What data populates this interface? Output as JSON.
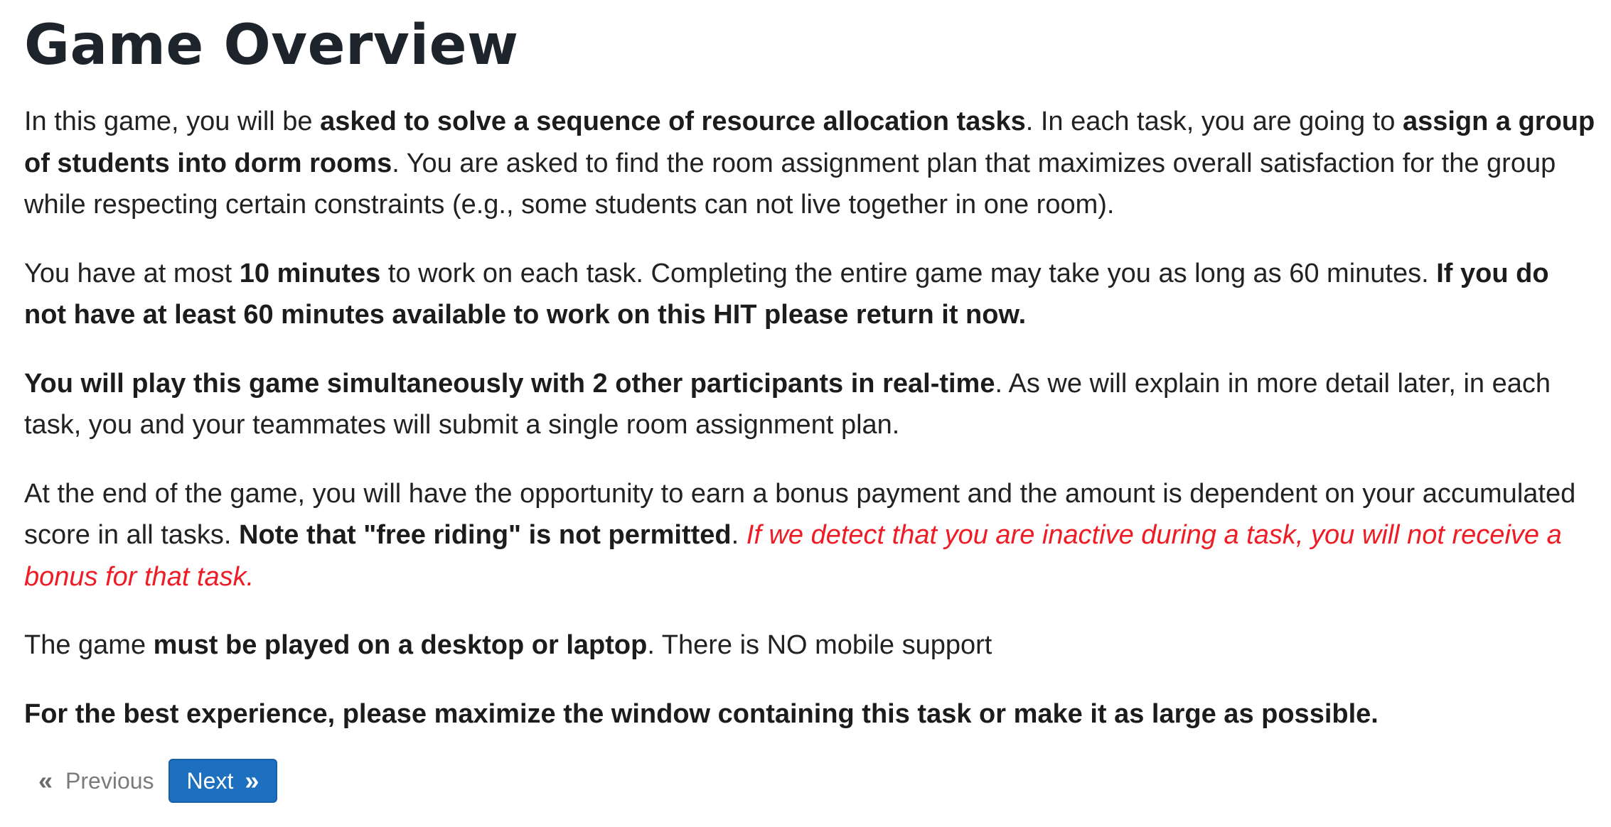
{
  "title": "Game Overview",
  "paragraphs": [
    [
      {
        "text": "In this game, you will be ",
        "style": "normal"
      },
      {
        "text": "asked to solve a sequence of resource allocation tasks",
        "style": "bold"
      },
      {
        "text": ". In each task, you are going to ",
        "style": "normal"
      },
      {
        "text": "assign a group of students into dorm rooms",
        "style": "bold"
      },
      {
        "text": ". You are asked to find the room assignment plan that maximizes overall satisfaction for the group while respecting certain constraints (e.g., some students can not live together in one room).",
        "style": "normal"
      }
    ],
    [
      {
        "text": "You have at most ",
        "style": "normal"
      },
      {
        "text": "10 minutes",
        "style": "bold"
      },
      {
        "text": " to work on each task. Completing the entire game may take you as long as 60 minutes. ",
        "style": "normal"
      },
      {
        "text": "If you do not have at least 60 minutes available to work on this HIT please return it now.",
        "style": "bold"
      }
    ],
    [
      {
        "text": "You will play this game simultaneously with 2 other participants in real-time",
        "style": "bold"
      },
      {
        "text": ". As we will explain in more detail later, in each task, you and your teammates will submit a single room assignment plan.",
        "style": "normal"
      }
    ],
    [
      {
        "text": "At the end of the game, you will have the opportunity to earn a bonus payment and the amount is dependent on your accumulated score in all tasks. ",
        "style": "normal"
      },
      {
        "text": "Note that \"free riding\" is not permitted",
        "style": "bold"
      },
      {
        "text": ". ",
        "style": "normal"
      },
      {
        "text": "If we detect that you are inactive during a task, you will not receive a bonus for that task.",
        "style": "warn"
      }
    ],
    [
      {
        "text": "The game ",
        "style": "normal"
      },
      {
        "text": "must be played on a desktop or laptop",
        "style": "bold"
      },
      {
        "text": ". There is NO mobile support",
        "style": "normal"
      }
    ],
    [
      {
        "text": "For the best experience, please maximize the window containing this task or make it as large as possible.",
        "style": "bold"
      }
    ]
  ],
  "pager": {
    "previous_label": "Previous",
    "next_label": "Next",
    "previous_icon": "double-chevron-left-icon",
    "next_icon": "double-chevron-right-icon"
  },
  "colors": {
    "warning": "#ee1c25",
    "primary_button": "#1d6fbf"
  }
}
